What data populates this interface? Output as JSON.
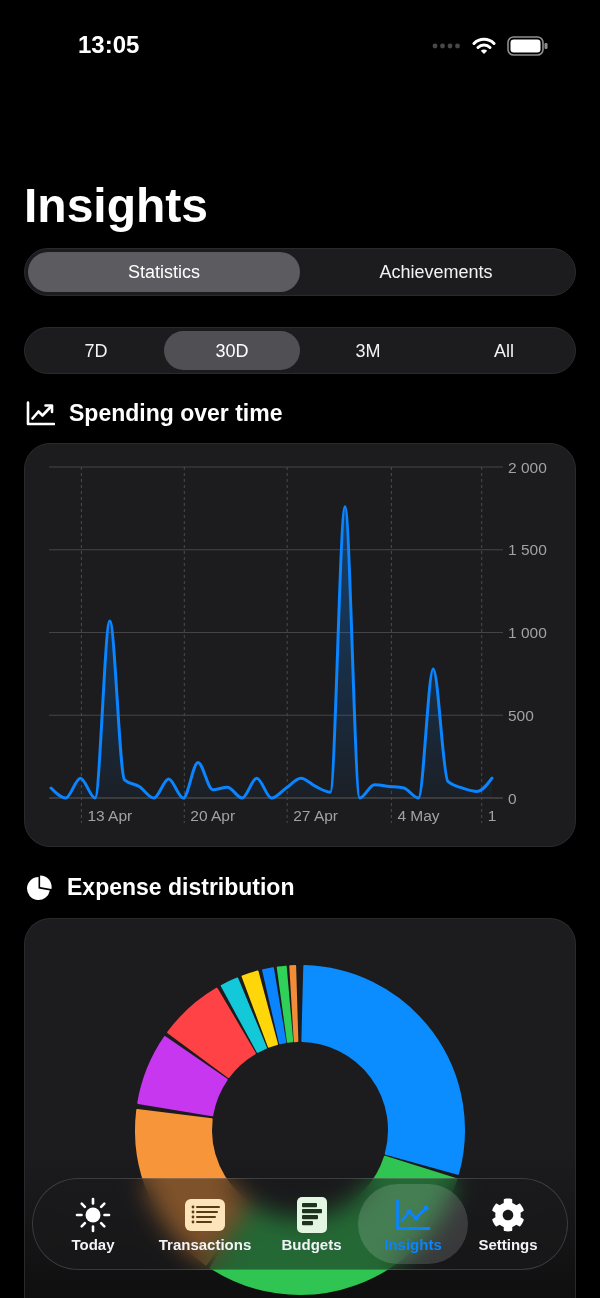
{
  "status_bar": {
    "time": "13:05"
  },
  "title": "Insights",
  "view_tabs": [
    {
      "label": "Statistics",
      "selected": true
    },
    {
      "label": "Achievements",
      "selected": false
    }
  ],
  "range_tabs": [
    {
      "label": "7D",
      "selected": false
    },
    {
      "label": "30D",
      "selected": true
    },
    {
      "label": "3M",
      "selected": false
    },
    {
      "label": "All",
      "selected": false
    }
  ],
  "spending_section": {
    "title": "Spending over time",
    "chart_data": {
      "type": "area",
      "categories": [
        null,
        null,
        null,
        null,
        "13 Apr",
        null,
        null,
        null,
        null,
        null,
        null,
        "20 Apr",
        null,
        null,
        null,
        null,
        null,
        null,
        "27 Apr",
        null,
        null,
        null,
        null,
        null,
        null,
        "4 May",
        null,
        null,
        null,
        null,
        "1"
      ],
      "values": [
        60,
        0,
        120,
        0,
        1070,
        110,
        70,
        0,
        115,
        0,
        215,
        50,
        65,
        0,
        120,
        0,
        60,
        120,
        70,
        35,
        1760,
        0,
        80,
        70,
        60,
        0,
        780,
        100,
        60,
        40,
        120
      ],
      "ylim": [
        0,
        2000
      ],
      "yticks": [
        0,
        500,
        {
          "value": 1000,
          "label": "1 000"
        },
        {
          "value": 1500,
          "label": "1 500"
        },
        {
          "value": 2000,
          "label": "2 000"
        }
      ],
      "grid": true
    }
  },
  "distribution_section": {
    "title": "Expense distribution"
  },
  "tab_bar": [
    {
      "label": "Today",
      "selected": false
    },
    {
      "label": "Transactions",
      "selected": false
    },
    {
      "label": "Budgets",
      "selected": false
    },
    {
      "label": "Insights",
      "selected": true
    },
    {
      "label": "Settings",
      "selected": false
    }
  ]
}
